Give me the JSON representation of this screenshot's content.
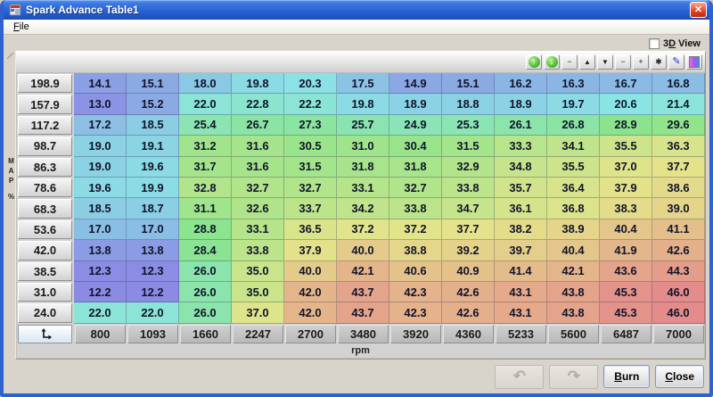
{
  "window": {
    "title": "Spark Advance Table1",
    "close_glyph": "✕"
  },
  "menu": {
    "file": {
      "first": "F",
      "rest": "ile"
    }
  },
  "view_toggle": {
    "pre": "3",
    "underlined": "D",
    "post": " View",
    "checked": false
  },
  "toolbar": {
    "buttons": [
      {
        "name": "circle-arrow-up",
        "icon": "ball-up"
      },
      {
        "name": "circle-arrow-down",
        "icon": "ball-down"
      },
      {
        "name": "minus-small",
        "icon": "minus"
      },
      {
        "name": "triangle-up",
        "icon": "tri-up"
      },
      {
        "name": "triangle-down",
        "icon": "tri-down"
      },
      {
        "name": "minus",
        "icon": "minus"
      },
      {
        "name": "plus",
        "icon": "plus"
      },
      {
        "name": "asterisk",
        "icon": "asterisk"
      },
      {
        "name": "pencil",
        "icon": "pencil"
      },
      {
        "name": "gradient",
        "icon": "gradient"
      }
    ]
  },
  "table": {
    "y_axis_letters": [
      "M",
      "A",
      "P"
    ],
    "y_axis_unit": "%",
    "x_axis_label": "rpm",
    "row_headers": [
      "198.9",
      "157.9",
      "117.2",
      "98.7",
      "86.3",
      "78.6",
      "68.3",
      "53.6",
      "42.0",
      "38.5",
      "31.0",
      "24.0"
    ],
    "col_headers": [
      "800",
      "1093",
      "1660",
      "2247",
      "2700",
      "3480",
      "3920",
      "4360",
      "5233",
      "5600",
      "6487",
      "7000"
    ],
    "rows": [
      [
        "14.1",
        "15.1",
        "18.0",
        "19.8",
        "20.3",
        "17.5",
        "14.9",
        "15.1",
        "16.2",
        "16.3",
        "16.7",
        "16.8"
      ],
      [
        "13.0",
        "15.2",
        "22.0",
        "22.8",
        "22.2",
        "19.8",
        "18.9",
        "18.8",
        "18.9",
        "19.7",
        "20.6",
        "21.4"
      ],
      [
        "17.2",
        "18.5",
        "25.4",
        "26.7",
        "27.3",
        "25.7",
        "24.9",
        "25.3",
        "26.1",
        "26.8",
        "28.9",
        "29.6"
      ],
      [
        "19.0",
        "19.1",
        "31.2",
        "31.6",
        "30.5",
        "31.0",
        "30.4",
        "31.5",
        "33.3",
        "34.1",
        "35.5",
        "36.3"
      ],
      [
        "19.0",
        "19.6",
        "31.7",
        "31.6",
        "31.5",
        "31.8",
        "31.8",
        "32.9",
        "34.8",
        "35.5",
        "37.0",
        "37.7"
      ],
      [
        "19.6",
        "19.9",
        "32.8",
        "32.7",
        "32.7",
        "33.1",
        "32.7",
        "33.8",
        "35.7",
        "36.4",
        "37.9",
        "38.6"
      ],
      [
        "18.5",
        "18.7",
        "31.1",
        "32.6",
        "33.7",
        "34.2",
        "33.8",
        "34.7",
        "36.1",
        "36.8",
        "38.3",
        "39.0"
      ],
      [
        "17.0",
        "17.0",
        "28.8",
        "33.1",
        "36.5",
        "37.2",
        "37.2",
        "37.7",
        "38.2",
        "38.9",
        "40.4",
        "41.1"
      ],
      [
        "13.8",
        "13.8",
        "28.4",
        "33.8",
        "37.9",
        "40.0",
        "38.8",
        "39.2",
        "39.7",
        "40.4",
        "41.9",
        "42.6"
      ],
      [
        "12.3",
        "12.3",
        "26.0",
        "35.0",
        "40.0",
        "42.1",
        "40.6",
        "40.9",
        "41.4",
        "42.1",
        "43.6",
        "44.3"
      ],
      [
        "12.2",
        "12.2",
        "26.0",
        "35.0",
        "42.0",
        "43.7",
        "42.3",
        "42.6",
        "43.1",
        "43.8",
        "45.3",
        "46.0"
      ],
      [
        "22.0",
        "22.0",
        "26.0",
        "37.0",
        "42.0",
        "43.7",
        "42.3",
        "42.6",
        "43.1",
        "43.8",
        "45.3",
        "46.0"
      ]
    ]
  },
  "footer": {
    "burn": {
      "first": "B",
      "rest": "urn"
    },
    "close": {
      "first": "C",
      "rest": "lose"
    }
  }
}
